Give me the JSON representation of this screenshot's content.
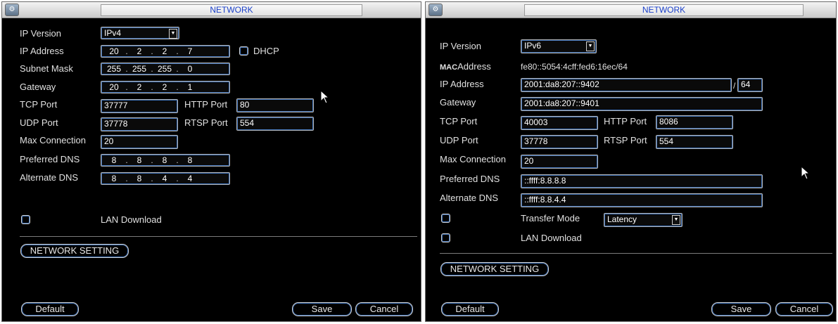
{
  "left": {
    "title": "NETWORK",
    "labels": {
      "ip_version": "IP Version",
      "ip_address": "IP Address",
      "subnet_mask": "Subnet Mask",
      "gateway": "Gateway",
      "tcp_port": "TCP Port",
      "http_port": "HTTP Port",
      "udp_port": "UDP Port",
      "rtsp_port": "RTSP Port",
      "max_connection": "Max Connection",
      "preferred_dns": "Preferred DNS",
      "alternate_dns": "Alternate DNS",
      "lan_download": "LAN Download",
      "dhcp": "DHCP"
    },
    "ip_version": "IPv4",
    "ip_address": [
      "20",
      "2",
      "2",
      "7"
    ],
    "subnet_mask": [
      "255",
      "255",
      "255",
      "0"
    ],
    "gateway": [
      "20",
      "2",
      "2",
      "1"
    ],
    "tcp_port": "37777",
    "http_port": "80",
    "udp_port": "37778",
    "rtsp_port": "554",
    "max_connection": "20",
    "preferred_dns": [
      "8",
      "8",
      "8",
      "8"
    ],
    "alternate_dns": [
      "8",
      "8",
      "4",
      "4"
    ],
    "network_setting_button": "NETWORK SETTING",
    "default_button": "Default",
    "save_button": "Save",
    "cancel_button": "Cancel"
  },
  "right": {
    "title": "NETWORK",
    "labels": {
      "ip_version": "IP Version",
      "mac_prefix": "MAC",
      "mac_address": "Address",
      "ip_address": "IP Address",
      "gateway": "Gateway",
      "tcp_port": "TCP Port",
      "http_port": "HTTP Port",
      "udp_port": "UDP Port",
      "rtsp_port": "RTSP Port",
      "max_connection": "Max Connection",
      "preferred_dns": "Preferred DNS",
      "alternate_dns": "Alternate DNS",
      "transfer_mode": "Transfer Mode",
      "lan_download": "LAN Download"
    },
    "ip_version": "IPv6",
    "mac_address": "fe80::5054:4cff:fed6:16ec/64",
    "ip_address": "2001:da8:207::9402",
    "prefix_sep": "/",
    "prefix_length": "64",
    "gateway": "2001:da8:207::9401",
    "tcp_port": "40003",
    "http_port": "8086",
    "udp_port": "37778",
    "rtsp_port": "554",
    "max_connection": "20",
    "preferred_dns": "::ffff:8.8.8.8",
    "alternate_dns": "::ffff:8.8.4.4",
    "transfer_mode": "Latency",
    "network_setting_button": "NETWORK SETTING",
    "default_button": "Default",
    "save_button": "Save",
    "cancel_button": "Cancel"
  },
  "colors": {
    "panel_bg": "#000000",
    "field_border": "#3c6fb6",
    "title_text": "#1a3fc8"
  },
  "icons": [
    "network-app-icon",
    "dropdown-arrow-icon",
    "mouse-cursor-icon",
    "checkbox"
  ]
}
